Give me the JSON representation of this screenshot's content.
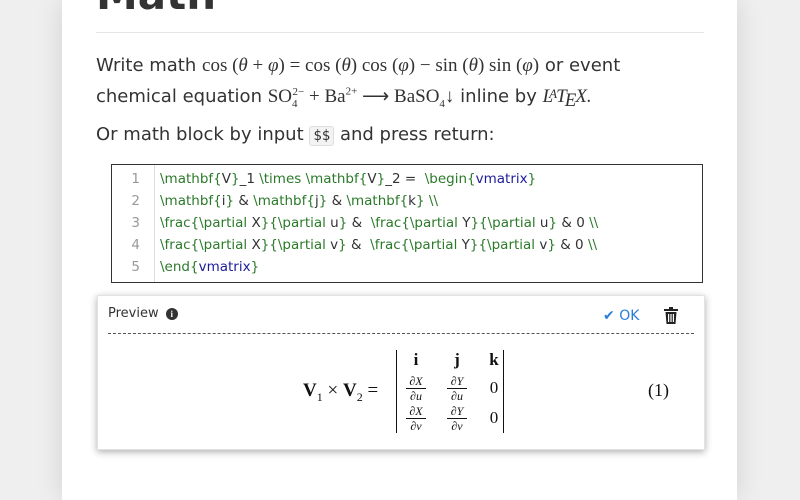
{
  "heading": "Math",
  "intro": {
    "write": "Write math",
    "or_event": "or event",
    "chem_prefix": "chemical equation",
    "inline_by": "inline by"
  },
  "block_text": {
    "prefix": "Or math block by input",
    "code": "$$",
    "suffix": "and press return:"
  },
  "editor": {
    "lines": [
      {
        "n": "1",
        "text": "\\mathbf{V}_1 \\times \\mathbf{V}_2 =  \\begin{vmatrix}"
      },
      {
        "n": "2",
        "text": "\\mathbf{i} & \\mathbf{j} & \\mathbf{k} \\\\"
      },
      {
        "n": "3",
        "text": "\\frac{\\partial X}{\\partial u} &  \\frac{\\partial Y}{\\partial u} & 0 \\\\"
      },
      {
        "n": "4",
        "text": "\\frac{\\partial X}{\\partial v} &  \\frac{\\partial Y}{\\partial v} & 0 \\\\"
      },
      {
        "n": "5",
        "text": "\\end{vmatrix}"
      }
    ]
  },
  "preview": {
    "label": "Preview",
    "ok_label": "OK",
    "equation_number": "(1)"
  },
  "icons": {
    "info": "info-circle-icon",
    "ok": "check-icon",
    "delete": "trash-icon"
  },
  "colors": {
    "accent": "#2a7ed8",
    "code_command": "#2b7a2b",
    "code_environment": "#1d1d9c"
  }
}
